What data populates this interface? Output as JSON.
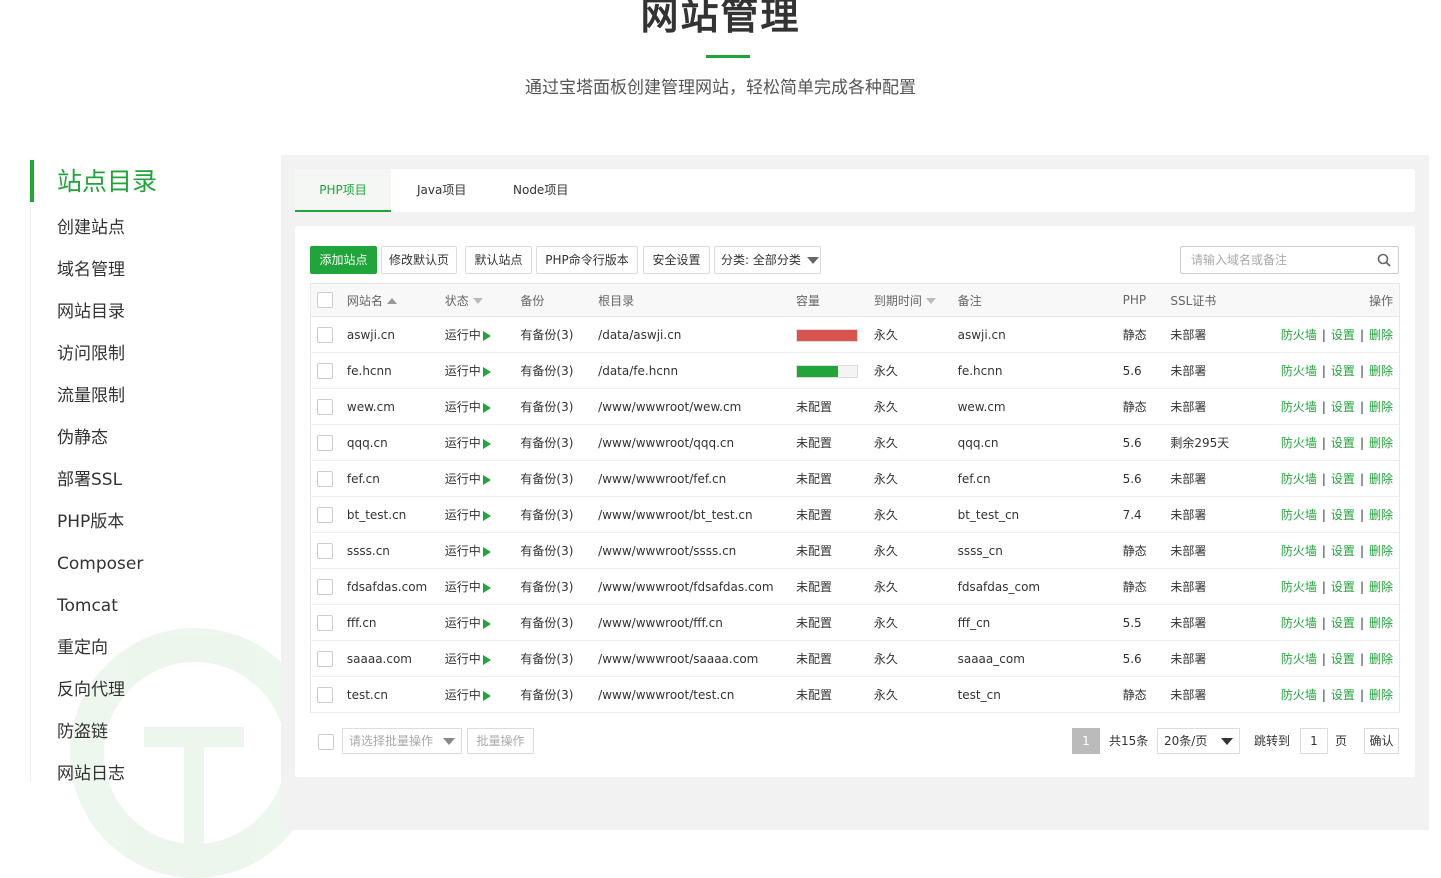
{
  "header": {
    "title": "网站管理",
    "subtitle": "通过宝塔面板创建管理网站，轻松简单完成各种配置"
  },
  "sidebar": {
    "heading": "站点目录",
    "items": [
      "创建站点",
      "域名管理",
      "网站目录",
      "访问限制",
      "流量限制",
      "伪静态",
      "部署SSL",
      "PHP版本",
      "Composer",
      "Tomcat",
      "重定向",
      "反向代理",
      "防盗链",
      "网站日志"
    ]
  },
  "tabs": [
    "PHP项目",
    "Java项目",
    "Node项目"
  ],
  "toolbar": {
    "add_site": "添加站点",
    "modify_default_page": "修改默认页",
    "default_site": "默认站点",
    "php_cli_version": "PHP命令行版本",
    "security_settings": "安全设置",
    "category": "分类: 全部分类",
    "search_placeholder": "请输入域名或备注"
  },
  "table": {
    "headers": [
      "网站名",
      "状态",
      "备份",
      "根目录",
      "容量",
      "到期时间",
      "备注",
      "PHP",
      "SSL证书",
      "操作"
    ],
    "rows": [
      {
        "name": "aswji.cn",
        "status": "运行中",
        "backup": "有备份(3)",
        "root": "/data/aswji.cn",
        "capacity": "",
        "capacity_level": 1.0,
        "capacity_color": "#d9534f",
        "expire": "永久",
        "remark": "aswji.cn",
        "php": "静态",
        "ssl": "未部署"
      },
      {
        "name": "fe.hcnn",
        "status": "运行中",
        "backup": "有备份(3)",
        "root": "/data/fe.hcnn",
        "capacity": "",
        "capacity_level": 0.68,
        "capacity_color": "#20a53a",
        "expire": "永久",
        "remark": "fe.hcnn",
        "php": "5.6",
        "ssl": "未部署"
      },
      {
        "name": "wew.cm",
        "status": "运行中",
        "backup": "有备份(3)",
        "root": "/www/wwwroot/wew.cm",
        "capacity": "未配置",
        "expire": "永久",
        "remark": "wew.cm",
        "php": "静态",
        "ssl": "未部署"
      },
      {
        "name": "qqq.cn",
        "status": "运行中",
        "backup": "有备份(3)",
        "root": "/www/wwwroot/qqq.cn",
        "capacity": "未配置",
        "expire": "永久",
        "remark": "qqq.cn",
        "php": "5.6",
        "ssl": "剩余295天"
      },
      {
        "name": "fef.cn",
        "status": "运行中",
        "backup": "有备份(3)",
        "root": "/www/wwwroot/fef.cn",
        "capacity": "未配置",
        "expire": "永久",
        "remark": "fef.cn",
        "php": "5.6",
        "ssl": "未部署"
      },
      {
        "name": "bt_test.cn",
        "status": "运行中",
        "backup": "有备份(3)",
        "root": "/www/wwwroot/bt_test.cn",
        "capacity": "未配置",
        "expire": "永久",
        "remark": "bt_test_cn",
        "php": "7.4",
        "ssl": "未部署"
      },
      {
        "name": "ssss.cn",
        "status": "运行中",
        "backup": "有备份(3)",
        "root": "/www/wwwroot/ssss.cn",
        "capacity": "未配置",
        "expire": "永久",
        "remark": "ssss_cn",
        "php": "静态",
        "ssl": "未部署"
      },
      {
        "name": "fdsafdas.com",
        "status": "运行中",
        "backup": "有备份(3)",
        "root": "/www/wwwroot/fdsafdas.com",
        "capacity": "未配置",
        "expire": "永久",
        "remark": "fdsafdas_com",
        "php": "静态",
        "ssl": "未部署"
      },
      {
        "name": "fff.cn",
        "status": "运行中",
        "backup": "有备份(3)",
        "root": "/www/wwwroot/fff.cn",
        "capacity": "未配置",
        "expire": "永久",
        "remark": "fff_cn",
        "php": "5.5",
        "ssl": "未部署"
      },
      {
        "name": "saaaa.com",
        "status": "运行中",
        "backup": "有备份(3)",
        "root": "/www/wwwroot/saaaa.com",
        "capacity": "未配置",
        "expire": "永久",
        "remark": "saaaa_com",
        "php": "5.6",
        "ssl": "未部署"
      },
      {
        "name": "test.cn",
        "status": "运行中",
        "backup": "有备份(3)",
        "root": "/www/wwwroot/test.cn",
        "capacity": "未配置",
        "expire": "永久",
        "remark": "test_cn",
        "php": "静态",
        "ssl": "未部署"
      }
    ],
    "actions": {
      "firewall": "防火墙",
      "settings": "设置",
      "delete": "删除"
    }
  },
  "footer": {
    "batch_placeholder": "请选择批量操作",
    "batch_button": "批量操作",
    "current_page": "1",
    "total": "共15条",
    "per_page": "20条/页",
    "jump_label": "跳转到",
    "jump_value": "1",
    "page_unit": "页",
    "confirm": "确认"
  },
  "colors": {
    "accent": "#20a53a",
    "warning": "#f0ad4e",
    "danger": "#d9534f"
  }
}
